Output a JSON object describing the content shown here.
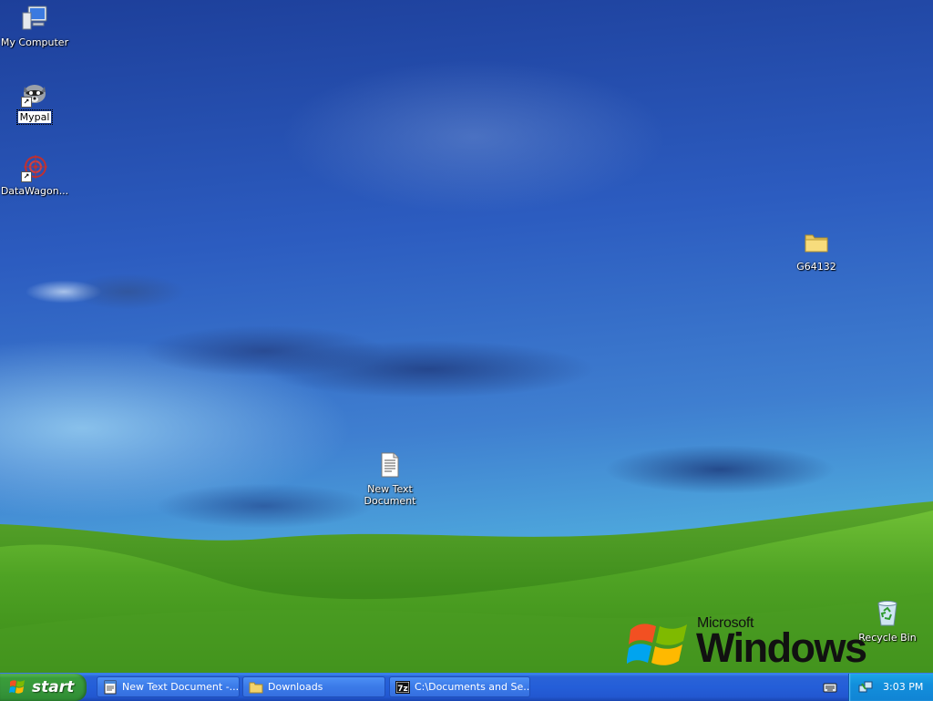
{
  "desktop": {
    "icons": [
      {
        "label": "My Computer"
      },
      {
        "label": "Mypal"
      },
      {
        "label": "DataWagon..."
      },
      {
        "label": "G64132"
      },
      {
        "label": "New Text Document"
      },
      {
        "label": "Recycle Bin"
      }
    ],
    "logo": {
      "brand": "Microsoft",
      "product": "Windows"
    }
  },
  "taskbar": {
    "start_label": "start",
    "tasks": [
      {
        "label": "New Text Document -...",
        "icon": "notepad-icon"
      },
      {
        "label": "Downloads",
        "icon": "folder-icon"
      },
      {
        "label": "C:\\Documents and Se...",
        "icon": "7zip-icon"
      }
    ],
    "clock": "3:03 PM"
  },
  "colors": {
    "taskbar_blue": "#245ed8",
    "start_green": "#3a9e3a",
    "tray_blue": "#128fdc",
    "selection": "#ffffff"
  }
}
